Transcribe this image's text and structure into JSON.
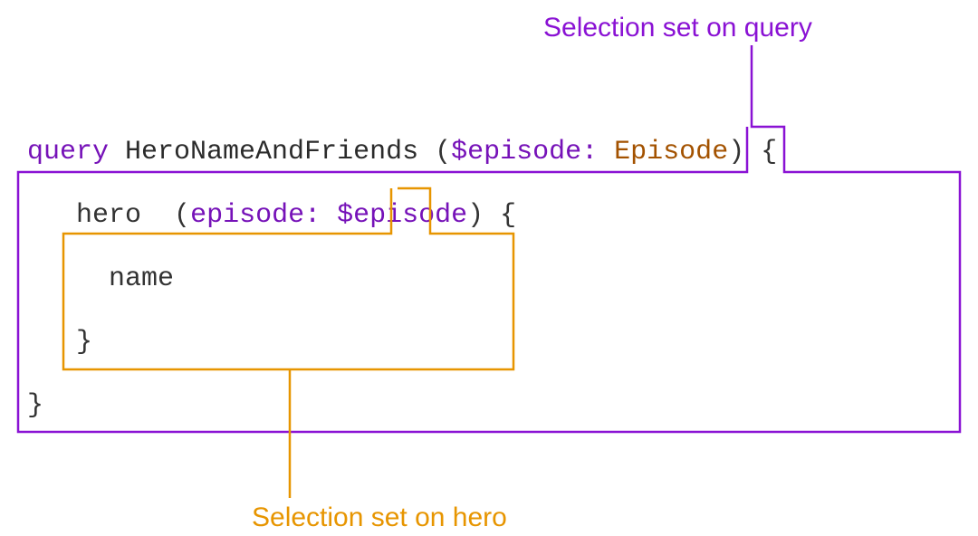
{
  "labels": {
    "outer": "Selection set on query",
    "inner": "Selection set on hero"
  },
  "colors": {
    "purple": "#8a12d4",
    "orange": "#e79500"
  },
  "code": {
    "kw_query": "query",
    "op_name": "HeroNameAndFriends",
    "paren_open": "(",
    "var_def": "$episode:",
    "type": "Episode",
    "paren_close": ")",
    "brace_open": "{",
    "field_hero": "hero",
    "arg_parenL": "(",
    "arg_name": "episode:",
    "arg_value": "$episode",
    "arg_parenR": ")",
    "brace_open2": "{",
    "field_name": "name",
    "brace_close2": "}",
    "brace_close": "}"
  }
}
